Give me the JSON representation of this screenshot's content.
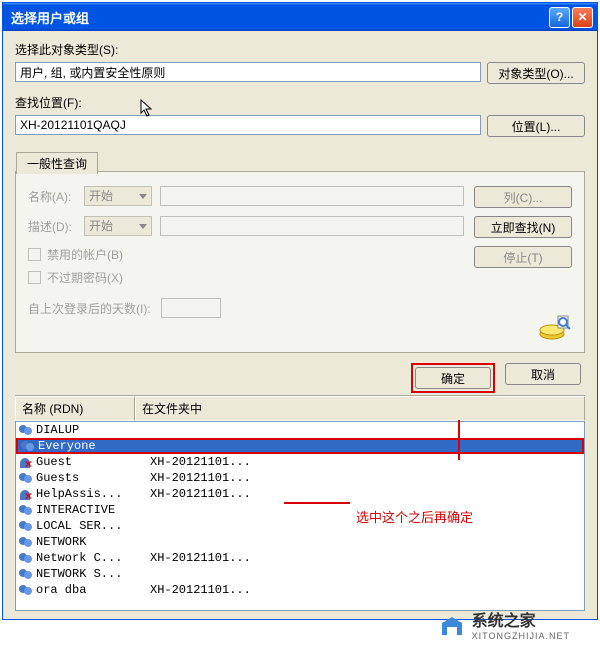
{
  "titlebar": {
    "title": "选择用户或组"
  },
  "labels": {
    "objectType": "选择此对象类型(S):",
    "location": "查找位置(F):",
    "name": "名称(A):",
    "desc": "描述(D):",
    "disabledAccount": "禁用的帐户(B)",
    "neverExpire": "不过期密码(X)",
    "daysSinceLogin": "自上次登录后的天数(I):"
  },
  "fields": {
    "objectType": "用户, 组, 或内置安全性原则",
    "location": "XH-20121101QAQJ",
    "nameMode": "开始",
    "descMode": "开始"
  },
  "buttons": {
    "objectTypes": "对象类型(O)...",
    "locations": "位置(L)...",
    "columns": "列(C)...",
    "findNow": "立即查找(N)",
    "stop": "停止(T)",
    "ok": "确定",
    "cancel": "取消"
  },
  "tab": {
    "general": "一般性查询"
  },
  "resultsHeader": {
    "name": "名称 (RDN)",
    "folder": "在文件夹中"
  },
  "results": [
    {
      "name": "DIALUP",
      "folder": "",
      "iconType": "group",
      "selected": false
    },
    {
      "name": "Everyone",
      "folder": "",
      "iconType": "group",
      "selected": true
    },
    {
      "name": "Guest",
      "folder": "XH-20121101...",
      "iconType": "user-x",
      "selected": false
    },
    {
      "name": "Guests",
      "folder": "XH-20121101...",
      "iconType": "group",
      "selected": false
    },
    {
      "name": "HelpAssis...",
      "folder": "XH-20121101...",
      "iconType": "user-x",
      "selected": false
    },
    {
      "name": "INTERACTIVE",
      "folder": "",
      "iconType": "group",
      "selected": false
    },
    {
      "name": "LOCAL SER...",
      "folder": "",
      "iconType": "group",
      "selected": false
    },
    {
      "name": "NETWORK",
      "folder": "",
      "iconType": "group",
      "selected": false
    },
    {
      "name": "Network C...",
      "folder": "XH-20121101...",
      "iconType": "group",
      "selected": false
    },
    {
      "name": "NETWORK S...",
      "folder": "",
      "iconType": "group",
      "selected": false
    },
    {
      "name": "ora dba",
      "folder": "XH-20121101...",
      "iconType": "group",
      "selected": false
    }
  ],
  "annotation": {
    "text": "选中这个之后再确定"
  },
  "watermark": {
    "big": "系统之家",
    "small": "XITONGZHIJIA.NET"
  }
}
